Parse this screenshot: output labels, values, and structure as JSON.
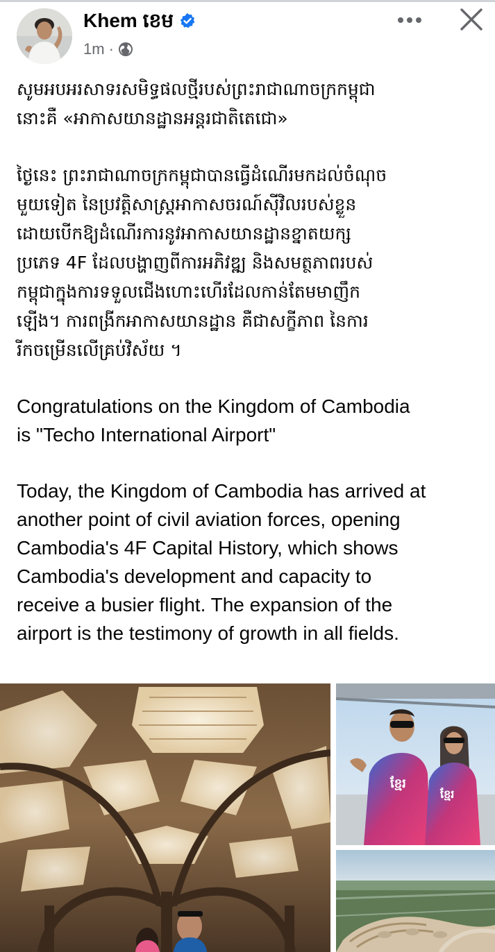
{
  "post": {
    "author": {
      "name": "Khem ខេម",
      "verified": true,
      "avatar_icon": "avatar-photo"
    },
    "timestamp": "1m",
    "audience_separator": "·",
    "audience_icon": "globe-icon",
    "actions": {
      "more_label": "•••",
      "close_label": "✕"
    },
    "text_paragraphs": {
      "km_intro_lines": [
        "សូមអបអរសាទរសមិទ្ធផលថ្មីរបស់ព្រះរាជាណាចក្រកម្ពុជា",
        "នោះគឺ «អាកាសយានដ្ឋានអន្តរជាតិតេជោ»"
      ],
      "km_body_lines": [
        "ថ្ងៃនេះ ព្រះរាជាណាចក្រកម្ពុជាបានធ្វើដំណើរមកដល់ចំណុច",
        "មួយទៀត នៃប្រវត្តិសាស្ត្រអាកាសចរណ៍ស៊ីវិលរបស់ខ្លួន",
        "ដោយបើកឱ្យដំណើរការនូវអាកាសយានដ្ឋានខ្នាតយក្ស",
        "ប្រភេទ 4F ដែលបង្ហាញពីការអភិវឌ្ឍ និងសមត្ថភាពរបស់",
        "កម្ពុជាក្នុងការទទួលជើងហោះហើរដែលកាន់តែមមាញឹក",
        "ឡើង។ ការពង្រីកអាកាសយានដ្ឋាន គឺជាសក្ខីភាព នៃការ",
        "រីកចម្រើនលើគ្រប់វិស័យ ។"
      ],
      "en_intro_lines": [
        "Congratulations on the Kingdom of Cambodia",
        "is \"Techo International Airport\""
      ],
      "en_body_lines": [
        "Today, the Kingdom of Cambodia has arrived at",
        "another point of civil aviation forces, opening",
        "Cambodia's 4F Capital History, which shows",
        "Cambodia's development and capacity to",
        "receive a busier flight. The expansion of the",
        "airport is the testimony of growth in all fields."
      ]
    },
    "photos": [
      {
        "icon": "airport-terminal-interior-photo"
      },
      {
        "icon": "couple-selfie-photo"
      },
      {
        "icon": "airport-aerial-photo"
      }
    ],
    "colors": {
      "verified_blue": "#1877f2",
      "meta_gray": "#65676b",
      "text": "#050505"
    }
  }
}
